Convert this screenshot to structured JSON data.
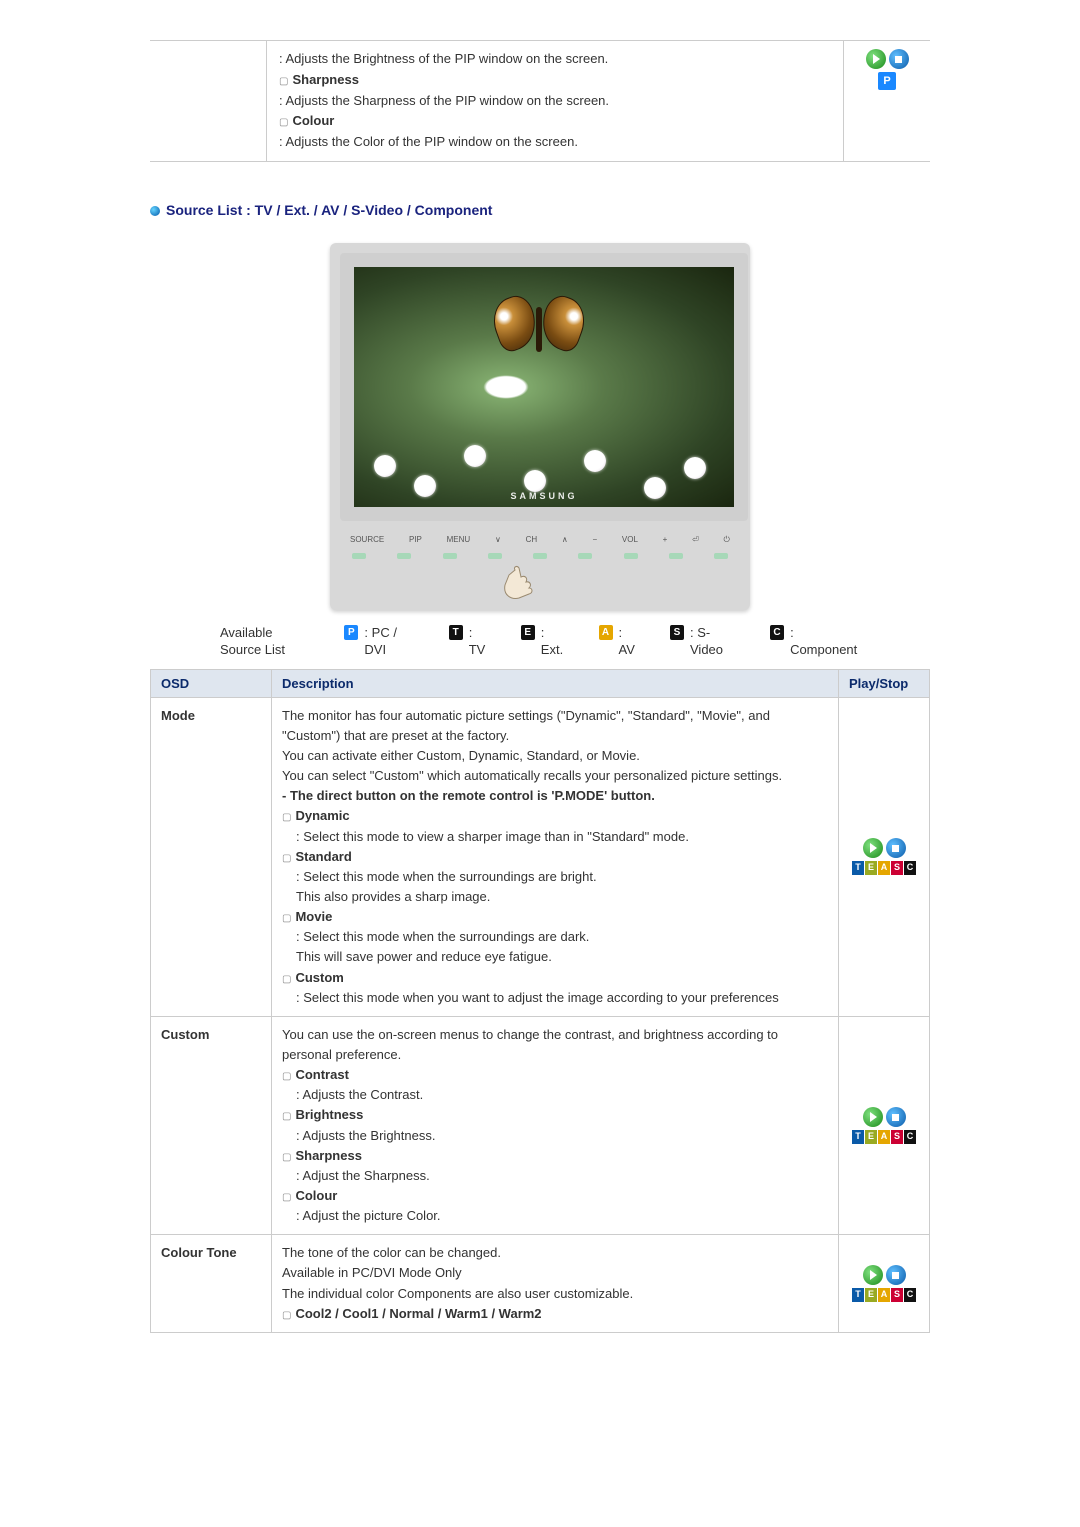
{
  "top": {
    "desc_brightness": ": Adjusts the Brightness of the PIP window on the screen.",
    "label_sharpness": "Sharpness",
    "desc_sharpness": ": Adjusts the Sharpness of the PIP window on the screen.",
    "label_colour": "Colour",
    "desc_colour": ": Adjusts the Color of the PIP window on the screen.",
    "p_badge": "P"
  },
  "section_title": "Source List : TV / Ext. / AV / S-Video / Component",
  "monitor": {
    "brand": "SAMSUNG",
    "controls": [
      "SOURCE",
      "PIP",
      "MENU",
      "∨",
      "CH",
      "∧",
      "−",
      "VOL",
      "+",
      "⏎",
      "⏻"
    ]
  },
  "legend": {
    "label": "Available Source List",
    "items": [
      {
        "badge": "P",
        "cls": "bP",
        "text": " : PC / DVI"
      },
      {
        "badge": "T",
        "cls": "bT",
        "text": " : TV"
      },
      {
        "badge": "E",
        "cls": "bE",
        "text": " : Ext."
      },
      {
        "badge": "A",
        "cls": "bA",
        "text": " : AV"
      },
      {
        "badge": "S",
        "cls": "bS",
        "text": " : S-Video"
      },
      {
        "badge": "C",
        "cls": "bC",
        "text": " : Component"
      }
    ]
  },
  "table": {
    "headers": {
      "osd": "OSD",
      "desc": "Description",
      "ps": "Play/Stop"
    },
    "rows": [
      {
        "osd": "Mode",
        "intro": "The monitor has four automatic picture settings (\"Dynamic\", \"Standard\", \"Movie\", and \"Custom\") that are preset at the factory.\nYou can activate either Custom, Dynamic, Standard, or Movie.\nYou can select \"Custom\" which automatically recalls your personalized picture settings.",
        "strong1": "- The direct button on the remote control is 'P.MODE' button.",
        "items": [
          {
            "name": "Dynamic",
            "desc": ": Select this mode to view a sharper image than in \"Standard\" mode."
          },
          {
            "name": "Standard",
            "desc": ": Select this mode when the surroundings are bright.\nThis also provides a sharp image."
          },
          {
            "name": "Movie",
            "desc": ": Select this mode when the surroundings are dark.\nThis will save power and reduce eye fatigue."
          },
          {
            "name": "Custom",
            "desc": ": Select this mode when you want to adjust the image according to your preferences"
          }
        ],
        "ps": "teasc"
      },
      {
        "osd": "Custom",
        "intro": "You can use the on-screen menus to change the contrast, and brightness according to personal preference.",
        "items": [
          {
            "name": "Contrast",
            "desc": ": Adjusts the Contrast."
          },
          {
            "name": "Brightness",
            "desc": ": Adjusts the Brightness."
          },
          {
            "name": "Sharpness",
            "desc": ": Adjust the Sharpness."
          },
          {
            "name": "Colour",
            "desc": ": Adjust the picture Color."
          }
        ],
        "ps": "teasc"
      },
      {
        "osd": "Colour Tone",
        "intro": "The tone of the color can be changed.\nAvailable in PC/DVI Mode Only\nThe individual color Components are also user customizable.",
        "items": [
          {
            "name": "Cool2 / Cool1 / Normal / Warm1 / Warm2",
            "desc": ""
          }
        ],
        "ps": "teasc"
      }
    ]
  },
  "teasc_letters": [
    "T",
    "E",
    "A",
    "S",
    "C"
  ]
}
